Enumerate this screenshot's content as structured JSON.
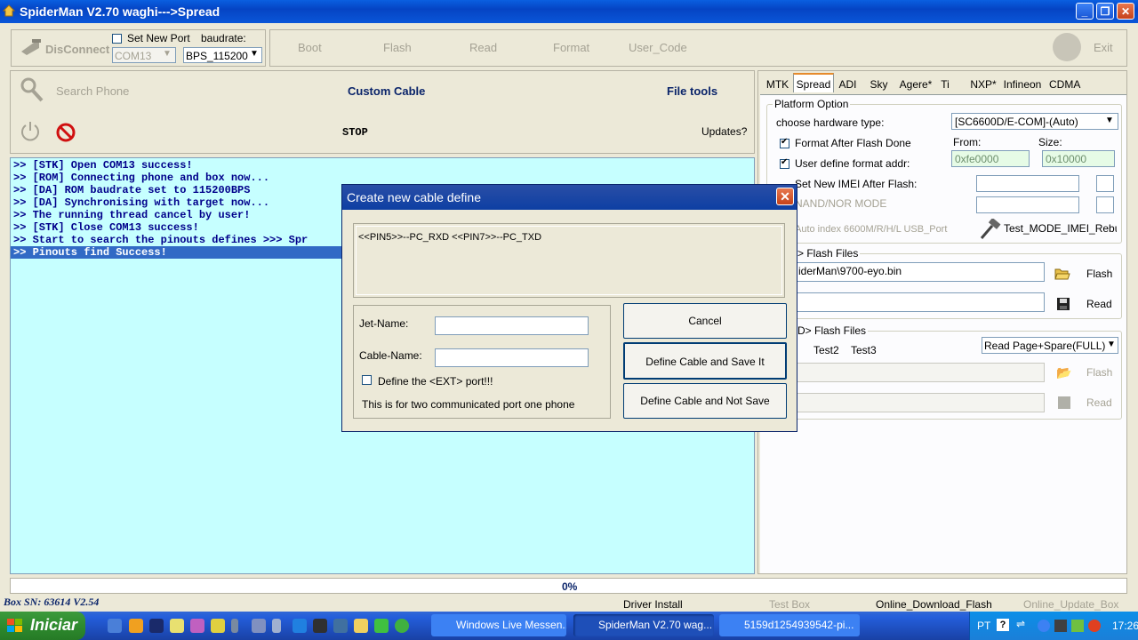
{
  "window": {
    "title": "SpiderMan V2.70 waghi--->Spread"
  },
  "toolbar": {
    "disconnect": "DisConnect",
    "set_new_port": "Set New Port",
    "baudrate_label": "baudrate:",
    "port_value": "COM13",
    "baud_value": "BPS_115200",
    "boot": "Boot",
    "flash": "Flash",
    "read": "Read",
    "format": "Format",
    "user_code": "User_Code",
    "exit": "Exit"
  },
  "actions": {
    "search_phone": "Search Phone",
    "custom_cable": "Custom Cable",
    "file_tools": "File tools",
    "stop": "STOP",
    "updates": "Updates?"
  },
  "log": [
    ">> [STK] Open COM13 success!",
    ">> [ROM] Connecting phone and box now...",
    ">> [DA] ROM baudrate set to 115200BPS",
    ">> [DA] Synchronising with target now...",
    ">> The running thread cancel by user!",
    ">> [STK] Close COM13 success!",
    ">> Start to search the pinouts defines >>> Spr",
    ">> Pinouts find Success!"
  ],
  "tabs": [
    "MTK",
    "Spread",
    "ADI",
    "Sky",
    "Agere*",
    "Ti",
    "NXP*",
    "Infineon",
    "CDMA"
  ],
  "active_tab": "Spread",
  "platform": {
    "group_label": "Platform Option",
    "hw_label": "choose hardware type:",
    "hw_value": "[SC6600D/E-COM]-(Auto)",
    "format_after_flash": "Format After Flash Done",
    "user_define_format": "User define format addr:",
    "set_new_imei": "Set New IMEI After Flash:",
    "nand_nor": "NAND/NOR MODE",
    "auto_index": "Auto index 6600M/R/H/L  USB_Port",
    "test_mode": "Test_MODE_IMEI_Rebuild",
    "from_label": "From:",
    "size_label": "Size:",
    "from_value": "0xfe0000",
    "size_value": "0x10000"
  },
  "flash_files": {
    "group_label": "> Flash Files",
    "file_value": "iderMan\\9700-eyo.bin",
    "flash": "Flash",
    "read": "Read"
  },
  "nand_files": {
    "group_label": "D> Flash Files",
    "test2": "Test2",
    "test3": "Test3",
    "mode_value": "Read Page+Spare(FULL)",
    "flash": "Flash",
    "read": "Read"
  },
  "dialog": {
    "title": "Create new cable define",
    "pins": "<<PIN5>>--PC_RXD <<PIN7>>--PC_TXD",
    "jet_name_label": "Jet-Name:",
    "cable_name_label": "Cable-Name:",
    "ext_port": "Define the <EXT> port!!!",
    "note": "This is for two communicated port one phone",
    "cancel": "Cancel",
    "save": "Define Cable and Save It",
    "not_save": "Define Cable and Not Save"
  },
  "status": {
    "progress": "0%",
    "box_sn": "Box SN: 63614  V2.54",
    "driver_install": "Driver Install",
    "test_box": "Test Box",
    "online_download": "Online_Download_Flash",
    "online_update": "Online_Update_Box"
  },
  "taskbar": {
    "start": "Iniciar",
    "items": [
      "Windows Live Messen...",
      "SpiderMan V2.70 wag...",
      "5159d1254939542-pi..."
    ],
    "lang": "PT",
    "time": "17:26"
  },
  "colors": {
    "console_bg": "#c6ffff",
    "console_text": "#00008b",
    "title_blue": "#0a5fe0",
    "selected_line": "#316ac5"
  }
}
